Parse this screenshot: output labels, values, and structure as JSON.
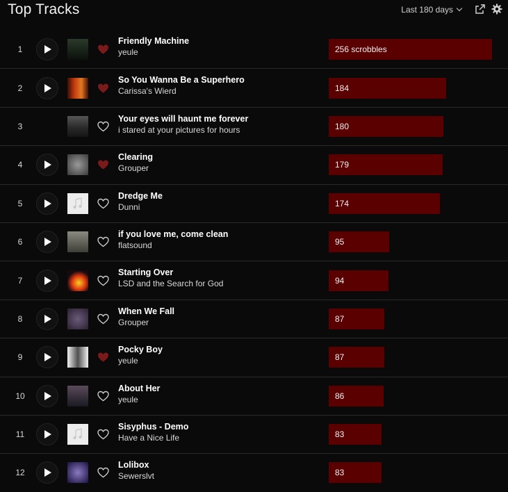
{
  "header": {
    "title": "Top Tracks",
    "period": "Last 180 days",
    "icons": [
      "share-icon",
      "gear-icon"
    ]
  },
  "colors": {
    "background": "#0a0a0a",
    "bar": "#5a0000",
    "heart_loved": "#7a1a1a",
    "heart_outline": "#c8c8c8"
  },
  "tracks": [
    {
      "rank": "1",
      "title": "Friendly Machine",
      "artist": "yeule",
      "scrobbles": "256 scrobbles",
      "count": 256,
      "loved": true,
      "playable": true
    },
    {
      "rank": "2",
      "title": "So You Wanna Be a Superhero",
      "artist": "Carissa's Wierd",
      "scrobbles": "184",
      "count": 184,
      "loved": true,
      "playable": true
    },
    {
      "rank": "3",
      "title": "Your eyes will haunt me forever",
      "artist": "i stared at your pictures for hours",
      "scrobbles": "180",
      "count": 180,
      "loved": false,
      "playable": false
    },
    {
      "rank": "4",
      "title": "Clearing",
      "artist": "Grouper",
      "scrobbles": "179",
      "count": 179,
      "loved": true,
      "playable": true
    },
    {
      "rank": "5",
      "title": "Dredge Me",
      "artist": "Dunni",
      "scrobbles": "174",
      "count": 174,
      "loved": false,
      "playable": true
    },
    {
      "rank": "6",
      "title": "if you love me, come clean",
      "artist": "flatsound",
      "scrobbles": "95",
      "count": 95,
      "loved": false,
      "playable": true
    },
    {
      "rank": "7",
      "title": "Starting Over",
      "artist": "LSD and the Search for God",
      "scrobbles": "94",
      "count": 94,
      "loved": false,
      "playable": true
    },
    {
      "rank": "8",
      "title": "When We Fall",
      "artist": "Grouper",
      "scrobbles": "87",
      "count": 87,
      "loved": false,
      "playable": true
    },
    {
      "rank": "9",
      "title": "Pocky Boy",
      "artist": "yeule",
      "scrobbles": "87",
      "count": 87,
      "loved": true,
      "playable": true
    },
    {
      "rank": "10",
      "title": "About Her",
      "artist": "yeule",
      "scrobbles": "86",
      "count": 86,
      "loved": false,
      "playable": true
    },
    {
      "rank": "11",
      "title": "Sisyphus - Demo",
      "artist": "Have a Nice Life",
      "scrobbles": "83",
      "count": 83,
      "loved": false,
      "playable": true
    },
    {
      "rank": "12",
      "title": "Lolibox",
      "artist": "Sewerslvt",
      "scrobbles": "83",
      "count": 83,
      "loved": false,
      "playable": true
    }
  ]
}
